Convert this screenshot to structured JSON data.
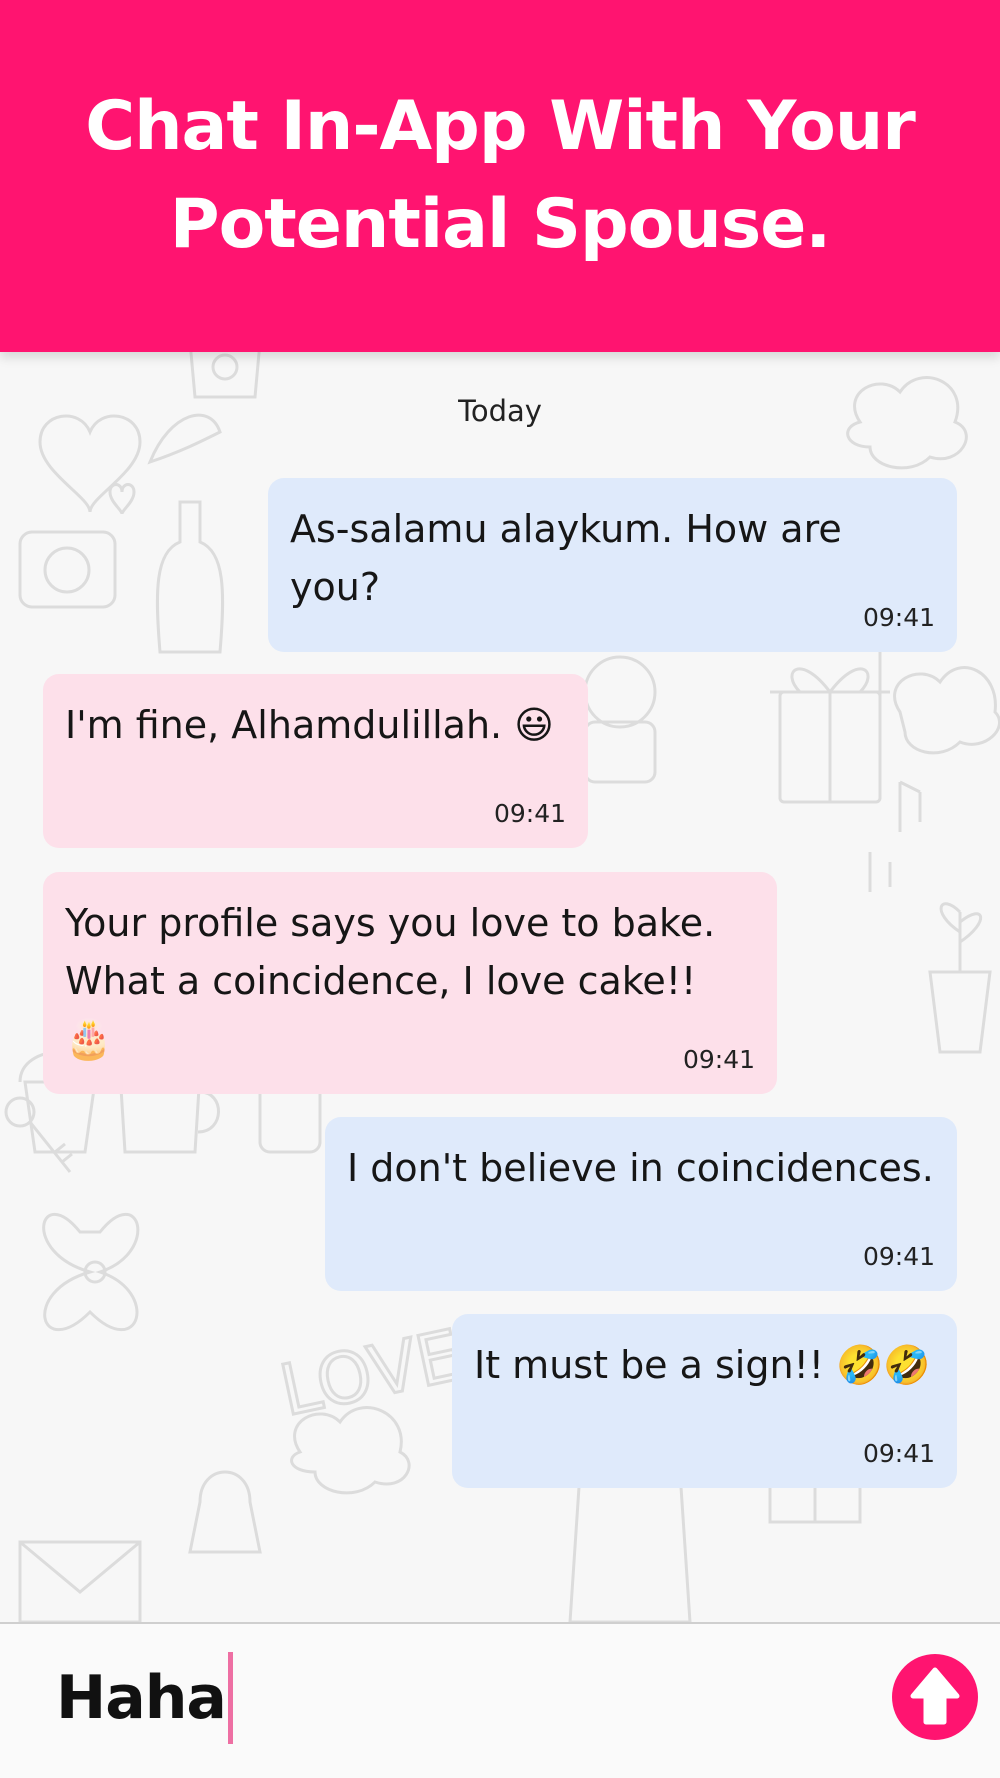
{
  "header": {
    "title_line1": "Chat In-App With Your",
    "title_line2": "Potential Spouse."
  },
  "chat": {
    "date_separator": "Today",
    "messages": [
      {
        "direction": "outgoing",
        "text": "As-salamu alaykum. How are you?",
        "time": "09:41"
      },
      {
        "direction": "incoming",
        "text": "I'm fine, Alhamdulillah. 😃",
        "time": "09:41"
      },
      {
        "direction": "incoming",
        "text": "Your profile says you love to bake.\nWhat a coincidence, I love cake!! 🎂",
        "time": "09:41"
      },
      {
        "direction": "outgoing",
        "text": "I don't believe in coincidences.",
        "time": "09:41"
      },
      {
        "direction": "outgoing",
        "text": "It must be a sign!! 🤣🤣",
        "time": "09:41"
      }
    ]
  },
  "composer": {
    "value": "Haha",
    "send_icon": "arrow-up-icon"
  },
  "colors": {
    "brand_pink": "#ff1470",
    "outgoing_bubble": "#dfeafb",
    "incoming_bubble": "#fde0ea"
  }
}
